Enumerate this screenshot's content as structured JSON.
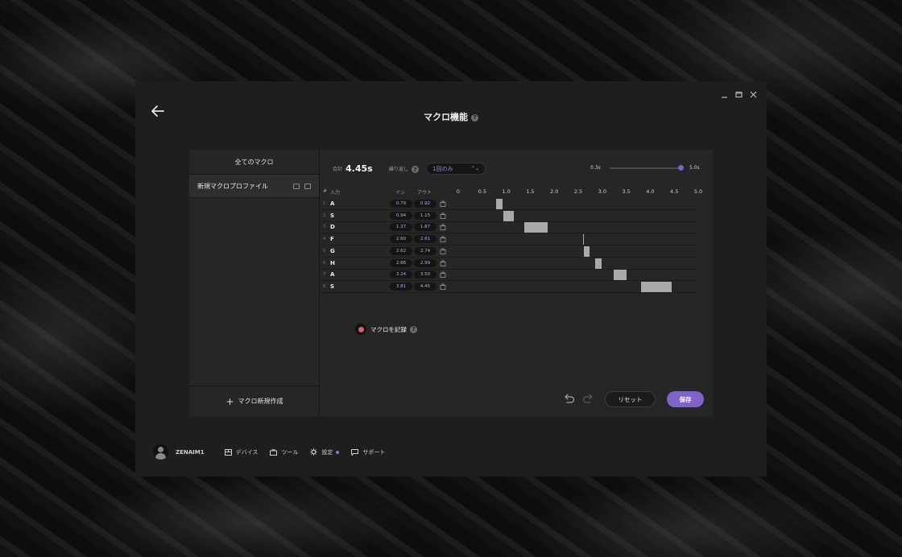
{
  "window": {
    "title": "マクロ機能",
    "controls": [
      "minimize-icon",
      "maximize-icon",
      "close-icon"
    ]
  },
  "sidebar": {
    "header": "全てのマクロ",
    "profiles": [
      {
        "label": "新規マクロプロファイル"
      }
    ],
    "new_button": "マクロ新規作成"
  },
  "summary": {
    "total_label": "合計",
    "total_value": "4.45s",
    "repeat_label": "繰り返し",
    "repeat_value": "1回のみ"
  },
  "zoom": {
    "min_label": "0.3s",
    "max_label": "5.0s",
    "value": 5.0
  },
  "table": {
    "columns": {
      "index": "#",
      "input": "入力",
      "in": "イン",
      "out": "アウト"
    },
    "scale": [
      "0",
      "0.5",
      "1.0",
      "1.5",
      "2.0",
      "2.5",
      "3.0",
      "3.5",
      "4.0",
      "4.5",
      "5.0"
    ],
    "rows": [
      {
        "num": "1",
        "key": "A",
        "in": "0.79",
        "out": "0.92"
      },
      {
        "num": "2",
        "key": "S",
        "in": "0.94",
        "out": "1.15"
      },
      {
        "num": "3",
        "key": "D",
        "in": "1.37",
        "out": "1.87"
      },
      {
        "num": "4",
        "key": "F",
        "in": "2.60",
        "out": "2.61"
      },
      {
        "num": "5",
        "key": "G",
        "in": "2.62",
        "out": "2.74"
      },
      {
        "num": "6",
        "key": "H",
        "in": "2.86",
        "out": "2.99"
      },
      {
        "num": "7",
        "key": "A",
        "in": "3.24",
        "out": "3.50"
      },
      {
        "num": "8",
        "key": "S",
        "in": "3.81",
        "out": "4.45"
      }
    ]
  },
  "record_label": "マクロを記録",
  "actions": {
    "reset": "リセット",
    "save": "保存"
  },
  "footer": {
    "username": "ZENAIM1",
    "nav": [
      {
        "label": "デバイス",
        "icon": "device-icon"
      },
      {
        "label": "ツール",
        "icon": "toolbox-icon"
      },
      {
        "label": "設定",
        "icon": "gear-icon"
      },
      {
        "label": "サポート",
        "icon": "chat-icon"
      }
    ]
  },
  "colors": {
    "accent": "#7e63c8",
    "record": "#d2616b",
    "bar": "#a9a9a9"
  }
}
